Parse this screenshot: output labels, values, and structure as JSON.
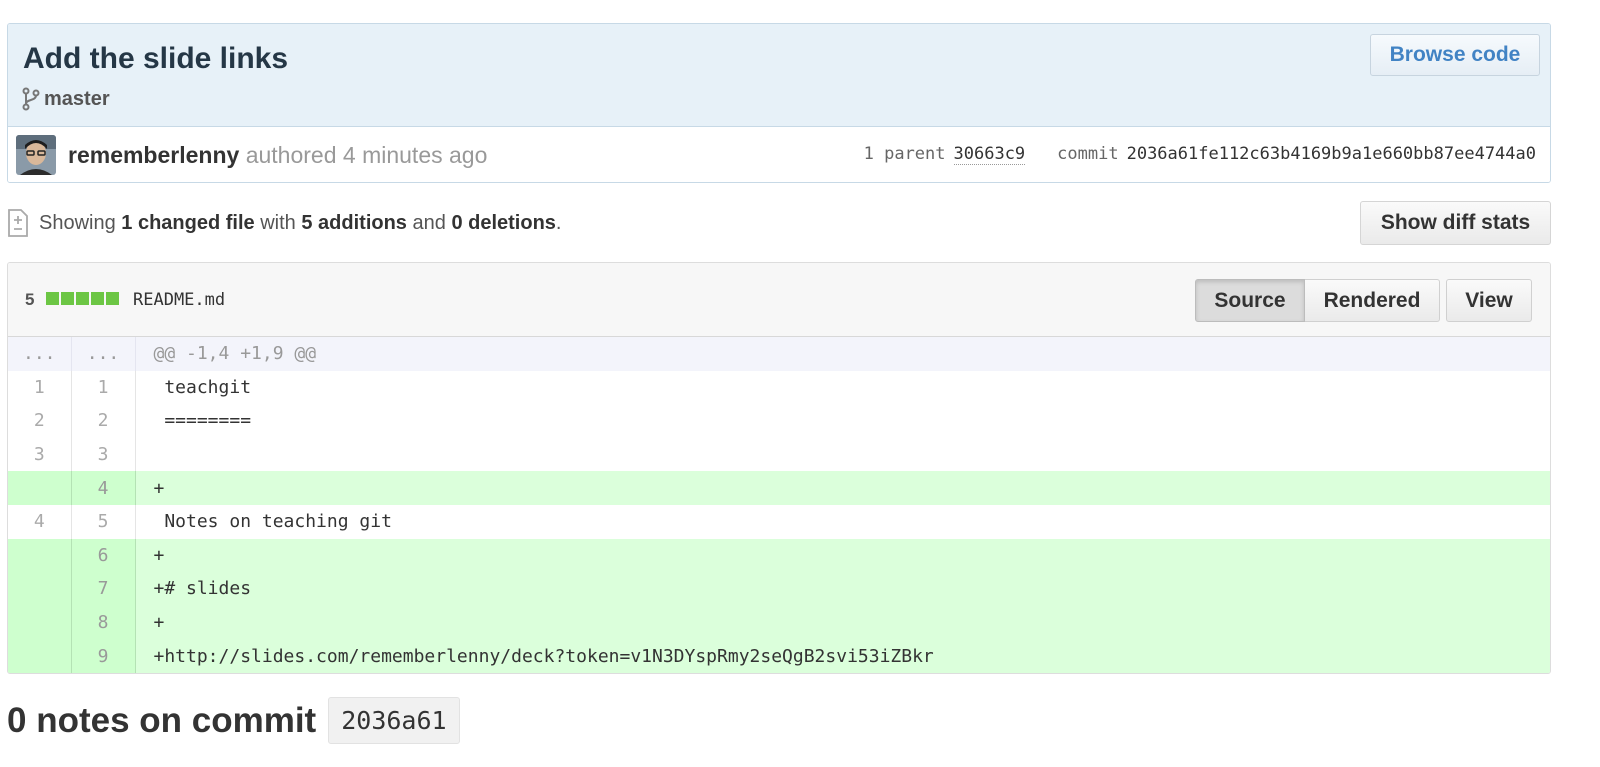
{
  "commit": {
    "title": "Add the slide links",
    "branch": "master",
    "browse_label": "Browse code",
    "author": "rememberlenny",
    "authored_text": "authored 4 minutes ago",
    "parent_label": "1 parent",
    "parent_sha": "30663c9",
    "commit_label": "commit",
    "commit_sha": "2036a61fe112c63b4169b9a1e660bb87ee4744a0"
  },
  "toc": {
    "showing": "Showing",
    "changed": "1 changed file",
    "with": "with",
    "additions": "5 additions",
    "and": "and",
    "deletions": "0 deletions",
    "period": ".",
    "diffstats_label": "Show diff stats"
  },
  "file": {
    "count": "5",
    "name": "README.md",
    "source_label": "Source",
    "rendered_label": "Rendered",
    "view_label": "View",
    "lines": [
      {
        "type": "hunk",
        "old": "...",
        "new": "...",
        "text": "@@ -1,4 +1,9 @@"
      },
      {
        "type": "ctx",
        "old": "1",
        "new": "1",
        "text": " teachgit"
      },
      {
        "type": "ctx",
        "old": "2",
        "new": "2",
        "text": " ========"
      },
      {
        "type": "ctx",
        "old": "3",
        "new": "3",
        "text": " "
      },
      {
        "type": "add",
        "old": "",
        "new": "4",
        "text": "+"
      },
      {
        "type": "ctx",
        "old": "4",
        "new": "5",
        "text": " Notes on teaching git"
      },
      {
        "type": "add",
        "old": "",
        "new": "6",
        "text": "+"
      },
      {
        "type": "add",
        "old": "",
        "new": "7",
        "text": "+# slides"
      },
      {
        "type": "add",
        "old": "",
        "new": "8",
        "text": "+"
      },
      {
        "type": "add",
        "old": "",
        "new": "9",
        "text": "+http://slides.com/rememberlenny/deck?token=v1N3DYspRmy2seQgB2svi53iZBkr"
      }
    ]
  },
  "notes": {
    "title": "0 notes on commit",
    "sha": "2036a61"
  },
  "colors": {
    "header_bg": "#e7f1f8",
    "addition_bg": "#dbffdb",
    "addition_block": "#6cc644",
    "link": "#4183c4"
  }
}
